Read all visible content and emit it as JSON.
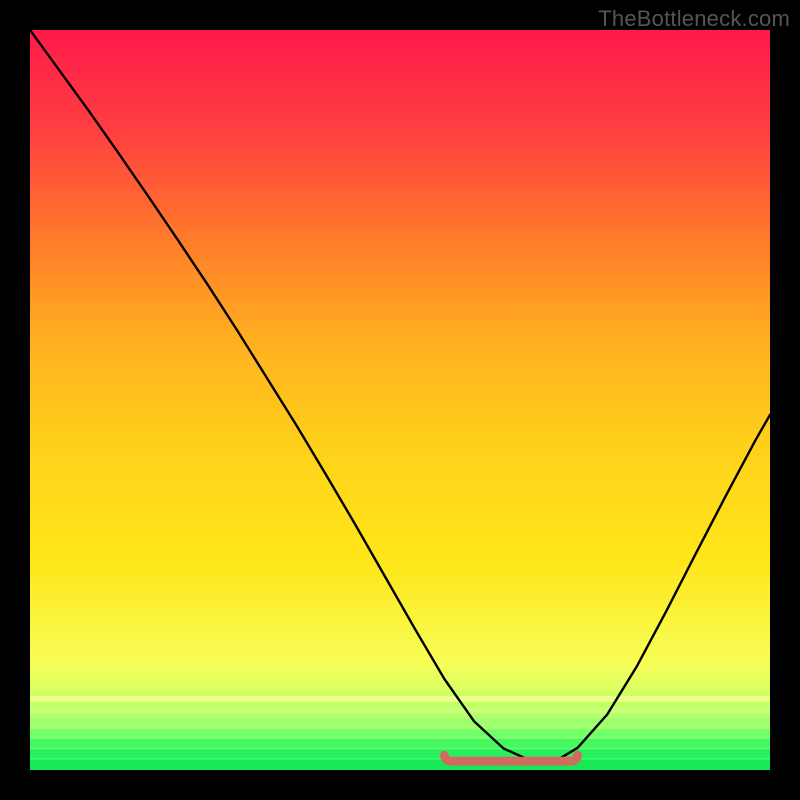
{
  "watermark": "TheBottleneck.com",
  "colors": {
    "frame": "#000000",
    "watermark": "#555555",
    "curve": "#000000",
    "bottom_mark": "#d46a5f",
    "green": "#17e854"
  },
  "chart_data": {
    "type": "line",
    "title": "",
    "xlabel": "",
    "ylabel": "",
    "xlim": [
      0,
      100
    ],
    "ylim": [
      0,
      100
    ],
    "grid": false,
    "legend": false,
    "annotations": [],
    "background_gradient_top_to_bottom": [
      "#ff1a4a",
      "#ff4040",
      "#ff7a2a",
      "#ffb020",
      "#ffd21a",
      "#ffe61a",
      "#f6ff59",
      "#a8ff6e",
      "#1aff75"
    ],
    "curve": {
      "name": "bottleneck-curve",
      "x": [
        0,
        4,
        8,
        12,
        16,
        20,
        24,
        28,
        32,
        36,
        40,
        44,
        48,
        52,
        56,
        60,
        64,
        68,
        71,
        74,
        78,
        82,
        86,
        90,
        94,
        98,
        100
      ],
      "y": [
        100,
        94.5,
        89,
        83.3,
        77.5,
        71.6,
        65.6,
        59.4,
        53,
        46.6,
        39.9,
        33.1,
        26.1,
        19.1,
        12.3,
        6.6,
        2.9,
        1.1,
        1.2,
        3.0,
        7.5,
        14.0,
        21.5,
        29.3,
        37.0,
        44.5,
        48.0
      ]
    },
    "flat_bottom_marker": {
      "x_start": 56,
      "x_end": 74,
      "y": 1.2,
      "thickness": 1.3,
      "color": "#d46a5f"
    }
  }
}
